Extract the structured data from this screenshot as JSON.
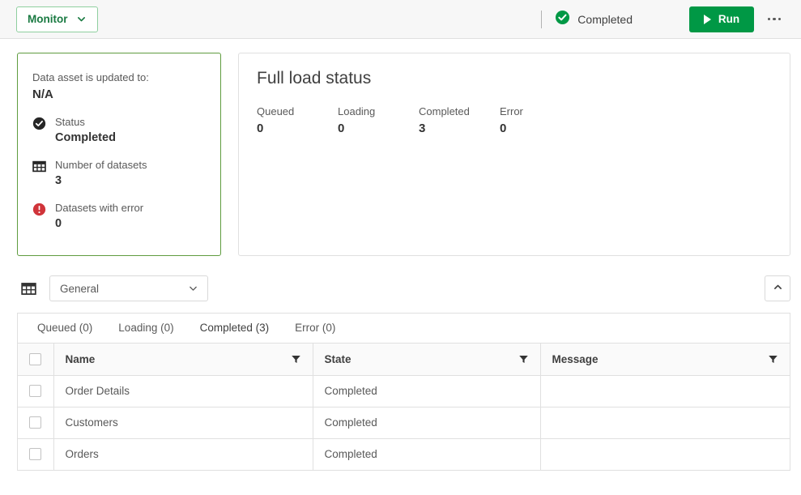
{
  "topbar": {
    "monitor_label": "Monitor",
    "monitor_chevron": "chevron-down-icon",
    "status_icon": "check-circle-icon",
    "status_label": "Completed",
    "run_label": "Run",
    "run_icon": "play-icon",
    "more_icon": "kebab-menu-icon"
  },
  "summary_card": {
    "asset_label": "Data asset is updated to:",
    "asset_value": "N/A",
    "stats": [
      {
        "icon": "check-circle-icon",
        "label": "Status",
        "value": "Completed"
      },
      {
        "icon": "table-grid-icon",
        "label": "Number of datasets",
        "value": "3"
      },
      {
        "icon": "error-circle-icon",
        "label": "Datasets with error",
        "value": "0"
      }
    ]
  },
  "load_card": {
    "title": "Full load status",
    "stats": [
      {
        "label": "Queued",
        "value": "0"
      },
      {
        "label": "Loading",
        "value": "0"
      },
      {
        "label": "Completed",
        "value": "3"
      },
      {
        "label": "Error",
        "value": "0"
      }
    ]
  },
  "toolbar": {
    "grid_icon": "table-grid-icon",
    "select_value": "General",
    "select_chevron": "chevron-down-icon",
    "collapse_icon": "chevron-up-icon"
  },
  "panel": {
    "tabs": [
      {
        "label": "Queued (0)",
        "active": false
      },
      {
        "label": "Loading (0)",
        "active": false
      },
      {
        "label": "Completed (3)",
        "active": true
      },
      {
        "label": "Error (0)",
        "active": false
      }
    ],
    "columns": [
      {
        "label": "Name",
        "filter": "filter-icon"
      },
      {
        "label": "State",
        "filter": "filter-icon"
      },
      {
        "label": "Message",
        "filter": "filter-icon"
      }
    ],
    "rows": [
      {
        "name": "Order Details",
        "state": "Completed",
        "message": ""
      },
      {
        "name": "Customers",
        "state": "Completed",
        "message": ""
      },
      {
        "name": "Orders",
        "state": "Completed",
        "message": ""
      }
    ]
  },
  "colors": {
    "brand_green": "#009845",
    "card_border_green": "#5f9c3f",
    "error_red": "#d0343a",
    "text_dark": "#404040",
    "text_muted": "#595959"
  }
}
